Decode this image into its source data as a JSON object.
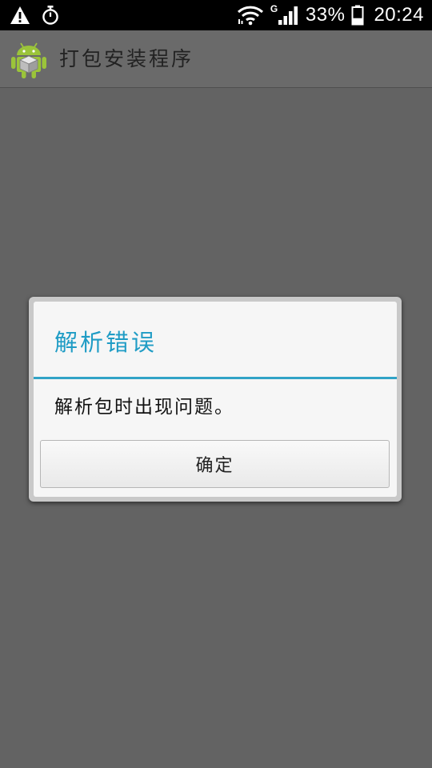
{
  "status_bar": {
    "icons_left": [
      "warning-icon",
      "stopwatch-icon"
    ],
    "icons_right": [
      "wifi-icon",
      "network-g-icon",
      "signal-icon",
      "battery-icon"
    ],
    "network_type": "G",
    "battery_percent": "33%",
    "battery_level": 0.33,
    "time": "20:24"
  },
  "app_bar": {
    "icon": "android-package-icon",
    "title": "打包安装程序"
  },
  "dialog": {
    "title": "解析错误",
    "message": "解析包时出现问题。",
    "ok_label": "确定",
    "accent_color": "#31a3c7"
  },
  "colors": {
    "background": "#636363",
    "status_bar": "#000000",
    "dialog_title": "#1f9cc5"
  }
}
